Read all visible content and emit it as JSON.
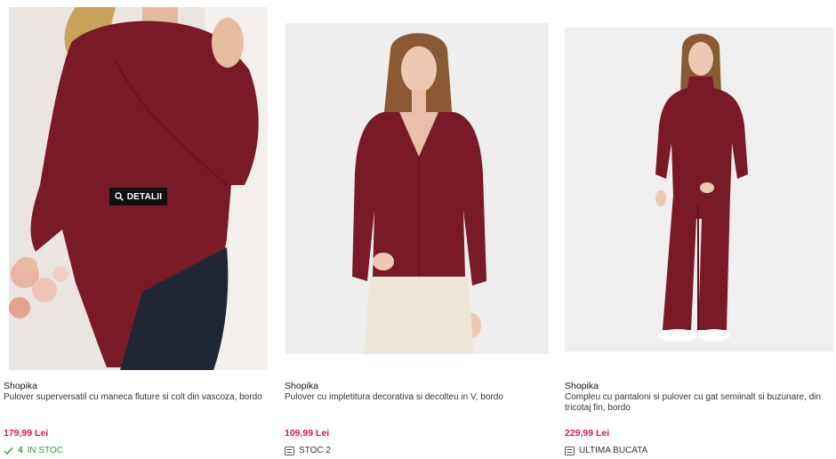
{
  "products": [
    {
      "brand": "Shopika",
      "title": "Pulover superversatil cu maneca fluture si colt din vascoza, bordo",
      "price": "179,99 Lei",
      "stock_count": "4",
      "stock_text": "IN STOC",
      "stock_icon": "check-icon",
      "quick_view_label": "DETALII",
      "image_icon": "product-photo"
    },
    {
      "brand": "Shopika",
      "title": "Pulover cu impletitura decorativa si decolteu in V, bordo",
      "price": "109,99 Lei",
      "stock_text": "STOC 2",
      "stock_icon": "stock-list-icon",
      "image_icon": "product-photo"
    },
    {
      "brand": "Shopika",
      "title": "Compleu cu pantaloni si pulover cu gat semiinalt si buzunare, din tricotaj fin, bordo",
      "price": "229,99 Lei",
      "stock_text": "ULTIMA BUCATA",
      "stock_icon": "stock-list-icon",
      "image_icon": "product-photo"
    }
  ],
  "colors": {
    "price": "#d11a4d",
    "in_stock": "#2a9d45",
    "garment": "#7a1a28"
  }
}
